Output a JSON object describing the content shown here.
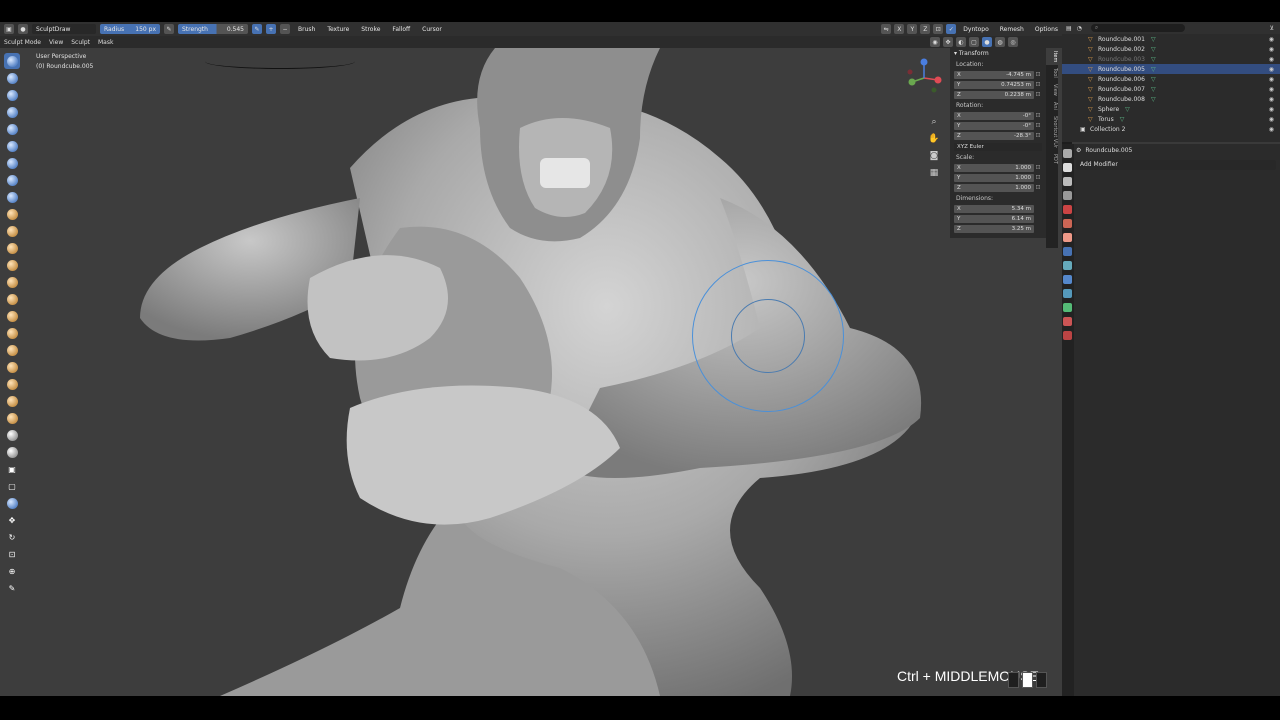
{
  "topbar": {
    "brush_name": "SculptDraw",
    "radius_label": "Radius",
    "radius_value": "150 px",
    "strength_label": "Strength",
    "strength_value": "0.545",
    "menus": [
      "Brush",
      "Texture",
      "Stroke",
      "Falloff",
      "Cursor"
    ],
    "dyntopo": "Dyntopo",
    "remesh": "Remesh",
    "options": "Options"
  },
  "secbar": {
    "mode": "Sculpt Mode",
    "menus": [
      "View",
      "Sculpt",
      "Mask"
    ]
  },
  "viewport": {
    "view_name": "User Perspective",
    "active_object": "(0) Roundcube.005",
    "hint": "Ctrl + MIDDLEMOUSE"
  },
  "npanel": {
    "title": "Transform",
    "location_label": "Location:",
    "location": [
      {
        "axis": "X",
        "value": "-4.745 m"
      },
      {
        "axis": "Y",
        "value": "0.74253 m"
      },
      {
        "axis": "Z",
        "value": "0.2238 m"
      }
    ],
    "rotation_label": "Rotation:",
    "rotation": [
      {
        "axis": "X",
        "value": "-0°"
      },
      {
        "axis": "Y",
        "value": "-0°"
      },
      {
        "axis": "Z",
        "value": "-28.3°"
      }
    ],
    "rotation_mode": "XYZ Euler",
    "scale_label": "Scale:",
    "scale": [
      {
        "axis": "X",
        "value": "1.000"
      },
      {
        "axis": "Y",
        "value": "1.000"
      },
      {
        "axis": "Z",
        "value": "1.000"
      }
    ],
    "dimensions_label": "Dimensions:",
    "dimensions": [
      {
        "axis": "X",
        "value": "5.34 m"
      },
      {
        "axis": "Y",
        "value": "6.14 m"
      },
      {
        "axis": "Z",
        "value": "3.25 m"
      }
    ],
    "tabs": [
      "Item",
      "Tool",
      "View",
      "Ani",
      "Shortcut VUr",
      "PDT"
    ]
  },
  "outliner": {
    "rows": [
      {
        "name": "Roundcube.001",
        "sel": false,
        "dim": false
      },
      {
        "name": "Roundcube.002",
        "sel": false,
        "dim": false
      },
      {
        "name": "Roundcube.003",
        "sel": false,
        "dim": true
      },
      {
        "name": "Roundcube.005",
        "sel": true,
        "dim": false
      },
      {
        "name": "Roundcube.006",
        "sel": false,
        "dim": false
      },
      {
        "name": "Roundcube.007",
        "sel": false,
        "dim": false
      },
      {
        "name": "Roundcube.008",
        "sel": false,
        "dim": false
      },
      {
        "name": "Sphere",
        "sel": false,
        "dim": false
      },
      {
        "name": "Torus",
        "sel": false,
        "dim": false
      },
      {
        "name": "Collection 2",
        "sel": false,
        "dim": false
      }
    ]
  },
  "properties": {
    "object_name": "Roundcube.005",
    "add_modifier": "Add Modifier"
  }
}
